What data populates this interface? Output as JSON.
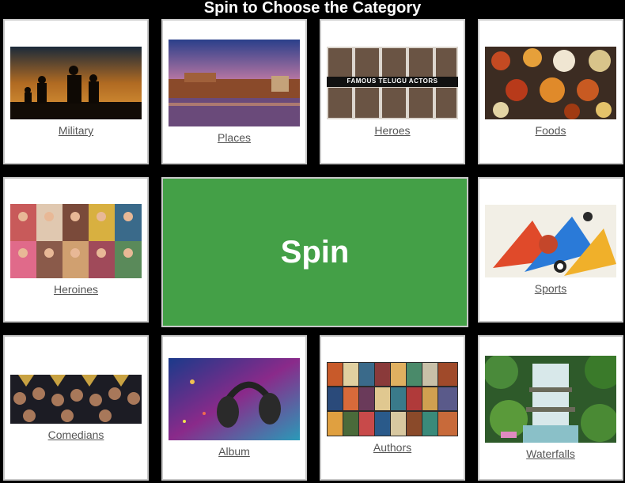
{
  "header": {
    "title": "Spin to Choose the Category"
  },
  "spin": {
    "label": "Spin"
  },
  "categories": [
    {
      "label": "Military"
    },
    {
      "label": "Places"
    },
    {
      "label": "Heroes"
    },
    {
      "label": "Foods"
    },
    {
      "label": "Heroines"
    },
    {
      "label": "Sports"
    },
    {
      "label": "Comedians"
    },
    {
      "label": "Album"
    },
    {
      "label": "Authors"
    },
    {
      "label": "Waterfalls"
    }
  ],
  "images": {
    "heroes_banner": "FAMOUS TELUGU ACTORS"
  },
  "colors": {
    "spin_bg": "#44a047",
    "background": "#000000"
  }
}
